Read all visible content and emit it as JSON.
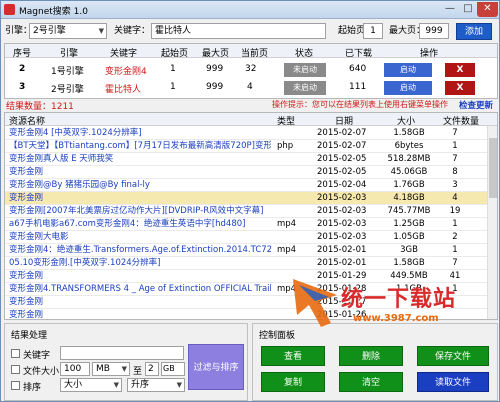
{
  "window": {
    "title": "Magnet搜索 1.0",
    "min": "—",
    "max": "□",
    "close": "✕"
  },
  "toolbar": {
    "engine_label": "引擎：",
    "engine_value": "2号引擎",
    "keyword_label": "关键字：",
    "keyword_value": "霍比特人",
    "start_page_label": "起始页：",
    "start_page_value": "1",
    "max_page_label": "最大页：",
    "max_page_value": "999",
    "add_button": "添加"
  },
  "tasks": {
    "headers": [
      "序号",
      "引擎",
      "关键字",
      "起始页",
      "最大页",
      "当前页",
      "状态",
      "已下载",
      "操作"
    ],
    "rows": [
      {
        "no": "2",
        "engine": "1号引擎",
        "keyword": "变形金刚4",
        "start": "1",
        "max": "999",
        "current": "32",
        "state": "未启动",
        "downloaded": "640",
        "start_btn": "启动",
        "del_btn": "X"
      },
      {
        "no": "3",
        "engine": "2号引擎",
        "keyword": "霍比特人",
        "start": "1",
        "max": "999",
        "current": "4",
        "state": "未启动",
        "downloaded": "111",
        "start_btn": "启动",
        "del_btn": "X"
      }
    ]
  },
  "status": {
    "count": "结果数量：1211",
    "tip": "操作提示：您可以在结果列表上使用右键菜单操作",
    "check_update": "检查更新"
  },
  "results": {
    "headers": [
      "资源名称",
      "类型",
      "日期",
      "大小",
      "文件数量"
    ],
    "rows": [
      {
        "name": "变形金刚4 [中英双字.1024分辨率]",
        "type": "",
        "date": "2015-02-07",
        "size": "1.58GB",
        "files": "7"
      },
      {
        "name": "【BT天堂】【BTtiantang.com】[7月17日发布最新高清版720P]变形金刚4",
        "type": "php",
        "date": "2015-02-07",
        "size": "6bytes",
        "files": "1"
      },
      {
        "name": "变形金刚真人版 E 天师我笑",
        "type": "",
        "date": "2015-02-05",
        "size": "518.28MB",
        "files": "7"
      },
      {
        "name": "变形金刚",
        "type": "",
        "date": "2015-02-05",
        "size": "45.06GB",
        "files": "8"
      },
      {
        "name": "变形金刚@By 猪猪乐园@By final-ly",
        "type": "",
        "date": "2015-02-04",
        "size": "1.76GB",
        "files": "3"
      },
      {
        "name": "变形金刚",
        "type": "",
        "date": "2015-02-03",
        "size": "4.18GB",
        "files": "4"
      },
      {
        "name": "变形金刚[2007年北美票房过亿动作大片][DVDRIP-R风效中文字幕]",
        "type": "",
        "date": "2015-02-03",
        "size": "745.77MB",
        "files": "19"
      },
      {
        "name": "a67手机电影a67.com变形金刚4：绝迹重生英语中字[hd480]",
        "type": "mp4",
        "date": "2015-02-03",
        "size": "1.25GB",
        "files": "1"
      },
      {
        "name": "变形金刚大电影",
        "type": "",
        "date": "2015-02-03",
        "size": "1.05GB",
        "files": "2"
      },
      {
        "name": "变形金刚4：绝迹重生.Transformers.Age.of.Extinction.2014.TC720",
        "type": "mp4",
        "date": "2015-02-01",
        "size": "3GB",
        "files": "1"
      },
      {
        "name": "05.10变形金刚.[中英双字.1024分辨率]",
        "type": "",
        "date": "2015-02-01",
        "size": "1.58GB",
        "files": "7"
      },
      {
        "name": "变形金刚",
        "type": "",
        "date": "2015-01-29",
        "size": "449.5MB",
        "files": "41"
      },
      {
        "name": "变形金刚4.TRANSFORMERS 4 _ Age of Extinction OFFICIAL Traile",
        "type": "mp4",
        "date": "2015-01-28",
        "size": "1.1GB",
        "files": "1"
      },
      {
        "name": "变形金刚",
        "type": "",
        "date": "2015-01-27",
        "size": "",
        "files": ""
      },
      {
        "name": "变形金刚",
        "type": "",
        "date": "2015-01-26",
        "size": "",
        "files": ""
      }
    ]
  },
  "filter_panel": {
    "title": "结果处理",
    "keyword_label": "关键字",
    "filecount_label": "文件大小",
    "size_from": "100",
    "size_from_unit": "MB",
    "to_label": "至",
    "size_to": "2",
    "size_to_unit": "GB",
    "sort_label": "排序",
    "sort_field": "大小",
    "sort_order": "升序",
    "apply_button": "过滤与排序"
  },
  "control_panel": {
    "title": "控制面板",
    "view": "查看",
    "delete": "删除",
    "save_file": "保存文件",
    "copy": "复制",
    "clear": "清空",
    "read_file": "读取文件"
  },
  "watermark": {
    "text": "统一下载站",
    "url": "www.3987.com"
  }
}
